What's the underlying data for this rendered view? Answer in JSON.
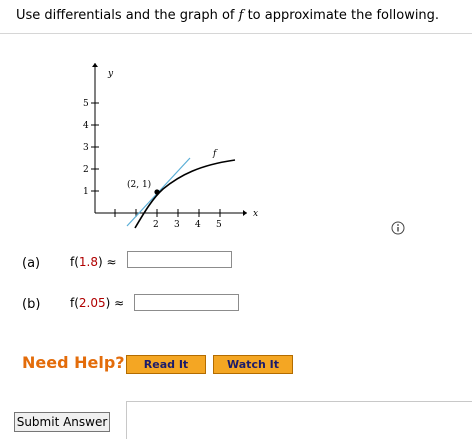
{
  "prompt": {
    "before": "Use differentials and the graph of ",
    "f": "f",
    "after": " to approximate the following."
  },
  "graph": {
    "y_axis_label": "y",
    "x_axis_label": "x",
    "curve_label": "f",
    "point_label": "(2, 1)",
    "y_ticks": [
      "5",
      "4",
      "3",
      "2",
      "1"
    ],
    "x_ticks": [
      "2",
      "3",
      "4",
      "5"
    ]
  },
  "parts": [
    {
      "label": "(a)",
      "fn": "f(",
      "arg": "1.8",
      "close": ") ≈",
      "value": ""
    },
    {
      "label": "(b)",
      "fn": "f(",
      "arg": "2.05",
      "close": ") ≈",
      "value": ""
    }
  ],
  "help": {
    "title": "Need Help?",
    "read_label": "Read It",
    "watch_label": "Watch It"
  },
  "submit_label": "Submit Answer",
  "colors": {
    "accent_orange": "#e36c0a",
    "button_orange": "#f4a623",
    "tangent_blue": "#5aaed6"
  }
}
